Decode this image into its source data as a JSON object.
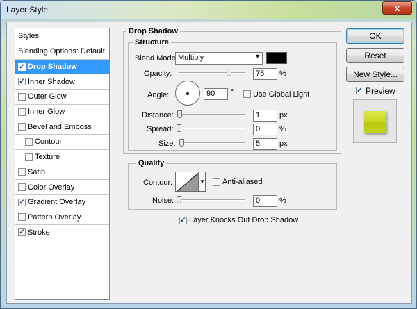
{
  "window": {
    "title": "Layer Style",
    "close_label": "x"
  },
  "styles_panel": {
    "header": "Styles",
    "items": [
      {
        "label": "Blending Options: Default",
        "has_checkbox": false,
        "checked": false,
        "selected": false,
        "indent": false
      },
      {
        "label": "Drop Shadow",
        "has_checkbox": true,
        "checked": true,
        "selected": true,
        "indent": false
      },
      {
        "label": "Inner Shadow",
        "has_checkbox": true,
        "checked": true,
        "selected": false,
        "indent": false
      },
      {
        "label": "Outer Glow",
        "has_checkbox": true,
        "checked": false,
        "selected": false,
        "indent": false
      },
      {
        "label": "Inner Glow",
        "has_checkbox": true,
        "checked": false,
        "selected": false,
        "indent": false
      },
      {
        "label": "Bevel and Emboss",
        "has_checkbox": true,
        "checked": false,
        "selected": false,
        "indent": false
      },
      {
        "label": "Contour",
        "has_checkbox": true,
        "checked": false,
        "selected": false,
        "indent": true
      },
      {
        "label": "Texture",
        "has_checkbox": true,
        "checked": false,
        "selected": false,
        "indent": true
      },
      {
        "label": "Satin",
        "has_checkbox": true,
        "checked": false,
        "selected": false,
        "indent": false
      },
      {
        "label": "Color Overlay",
        "has_checkbox": true,
        "checked": false,
        "selected": false,
        "indent": false
      },
      {
        "label": "Gradient Overlay",
        "has_checkbox": true,
        "checked": true,
        "selected": false,
        "indent": false
      },
      {
        "label": "Pattern Overlay",
        "has_checkbox": true,
        "checked": false,
        "selected": false,
        "indent": false
      },
      {
        "label": "Stroke",
        "has_checkbox": true,
        "checked": true,
        "selected": false,
        "indent": false
      }
    ]
  },
  "drop_shadow": {
    "title": "Drop Shadow",
    "structure_title": "Structure",
    "blend_mode_label": "Blend Mode:",
    "blend_mode_value": "Multiply",
    "shadow_color": "#000000",
    "opacity_label": "Opacity:",
    "opacity_value": "75",
    "opacity_unit": "%",
    "opacity_fraction": 0.75,
    "angle_label": "Angle:",
    "angle_value": "90",
    "angle_unit": "°",
    "use_global_light_label": "Use Global Light",
    "use_global_light_checked": false,
    "distance_label": "Distance:",
    "distance_value": "1",
    "distance_unit": "px",
    "spread_label": "Spread:",
    "spread_value": "0",
    "spread_unit": "%",
    "size_label": "Size:",
    "size_value": "5",
    "size_unit": "px",
    "quality_title": "Quality",
    "contour_label": "Contour:",
    "anti_aliased_label": "Anti-aliased",
    "anti_aliased_checked": false,
    "noise_label": "Noise:",
    "noise_value": "0",
    "noise_unit": "%",
    "knockout_label": "Layer Knocks Out Drop Shadow",
    "knockout_checked": true
  },
  "buttons": {
    "ok": "OK",
    "reset": "Reset",
    "new_style": "New Style...",
    "preview_label": "Preview",
    "preview_checked": true
  },
  "colors": {
    "selection": "#3399ff",
    "preview_swatch": "#c8d822"
  }
}
